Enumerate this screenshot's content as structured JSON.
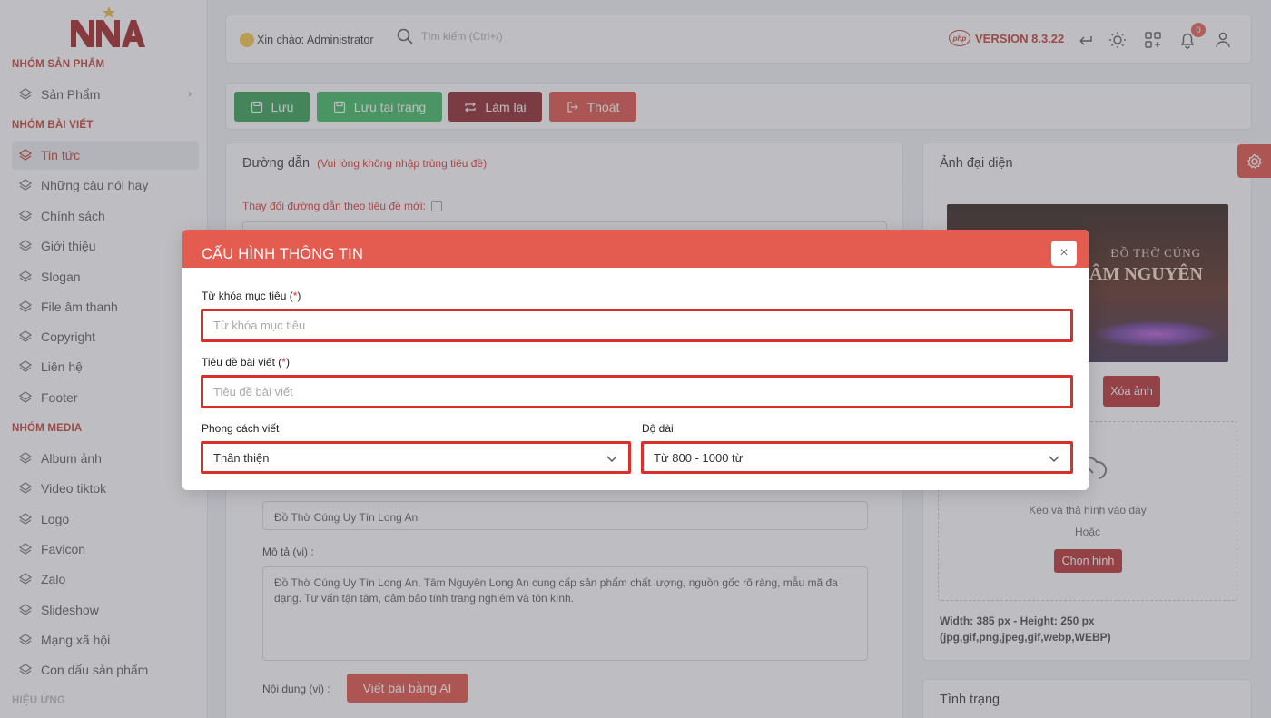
{
  "sidebar": {
    "logo_text": "NNA",
    "groups": [
      {
        "label": "NHÓM SẢN PHẨM"
      },
      {
        "label": "NHÓM BÀI VIẾT"
      },
      {
        "label": "NHÓM MEDIA"
      },
      {
        "label": "HIỆU ỨNG"
      }
    ],
    "items": [
      {
        "label": "Sản Phẩm"
      },
      {
        "label": "Tin tức"
      },
      {
        "label": "Những câu nói hay"
      },
      {
        "label": "Chính sách"
      },
      {
        "label": "Giới thiệu"
      },
      {
        "label": "Slogan"
      },
      {
        "label": "File âm thanh"
      },
      {
        "label": "Copyright"
      },
      {
        "label": "Liên hệ"
      },
      {
        "label": "Footer"
      },
      {
        "label": "Album ảnh"
      },
      {
        "label": "Video tiktok"
      },
      {
        "label": "Logo"
      },
      {
        "label": "Favicon"
      },
      {
        "label": "Zalo"
      },
      {
        "label": "Slideshow"
      },
      {
        "label": "Mạng xã hội"
      },
      {
        "label": "Con dấu sản phẩm"
      }
    ]
  },
  "topbar": {
    "greeting": "Xin chào: Administrator",
    "search_placeholder": "Tìm kiếm (Ctrl+/)",
    "php_badge": "php",
    "version": "VERSION 8.3.22",
    "notification_count": "0"
  },
  "actions": {
    "save": "Lưu",
    "save_stay": "Lưu tại trang",
    "reset": "Làm lại",
    "exit": "Thoát"
  },
  "colors": {
    "save": "#2e9d4f",
    "save_stay": "#39b75d",
    "reset": "#8b1e25",
    "exit": "#df4b42",
    "accent": "#e45b4f"
  },
  "main": {
    "path_title": "Đường dẫn",
    "path_note": "(Vui lòng không nhập trùng tiêu đề)",
    "path_checkbox_label": "Thay đổi đường dẫn theo tiêu đề mới:",
    "title_value": "Đồ Thờ Cúng Uy Tín Long An",
    "desc_label": "Mô tả (vi) :",
    "desc_value": "Đồ Thờ Cúng Uy Tín Long An, Tâm Nguyên Long An cung cấp sản phẩm chất lượng, nguồn gốc rõ ràng, mẫu mã đa dạng. Tư vấn tận tâm, đảm bảo tính trang nghiêm và tôn kính.",
    "content_label": "Nội dung (vi) :",
    "ai_button": "Viết bài bằng AI"
  },
  "right": {
    "avatar_title": "Ảnh đại diện",
    "image_text_1": "ĐỒ THỜ CÚNG",
    "image_text_2": "TÂM NGUYÊN",
    "delete_image": "Xóa ảnh",
    "drop_text": "Kéo và thả hình vào đây",
    "or_text": "Hoặc",
    "choose_image": "Chọn hình",
    "size_info": "Width: 385 px - Height: 250 px",
    "formats": "(jpg,gif,png,jpeg,gif,webp,WEBP)",
    "status_title": "Tình trạng"
  },
  "modal": {
    "title": "CẤU HÌNH THÔNG TIN",
    "keyword_label": "Từ khóa mục tiêu (",
    "keyword_req": "*",
    "keyword_placeholder": "Từ khóa mục tiêu",
    "post_title_label": "Tiêu đề bài viết (",
    "post_title_req": "*",
    "post_title_placeholder": "Tiêu đề bài viết",
    "style_label": "Phong cách viết",
    "style_value": "Thân thiện",
    "length_label": "Độ dài",
    "length_value": "Từ 800 - 1000 từ",
    "close_char": "×"
  }
}
